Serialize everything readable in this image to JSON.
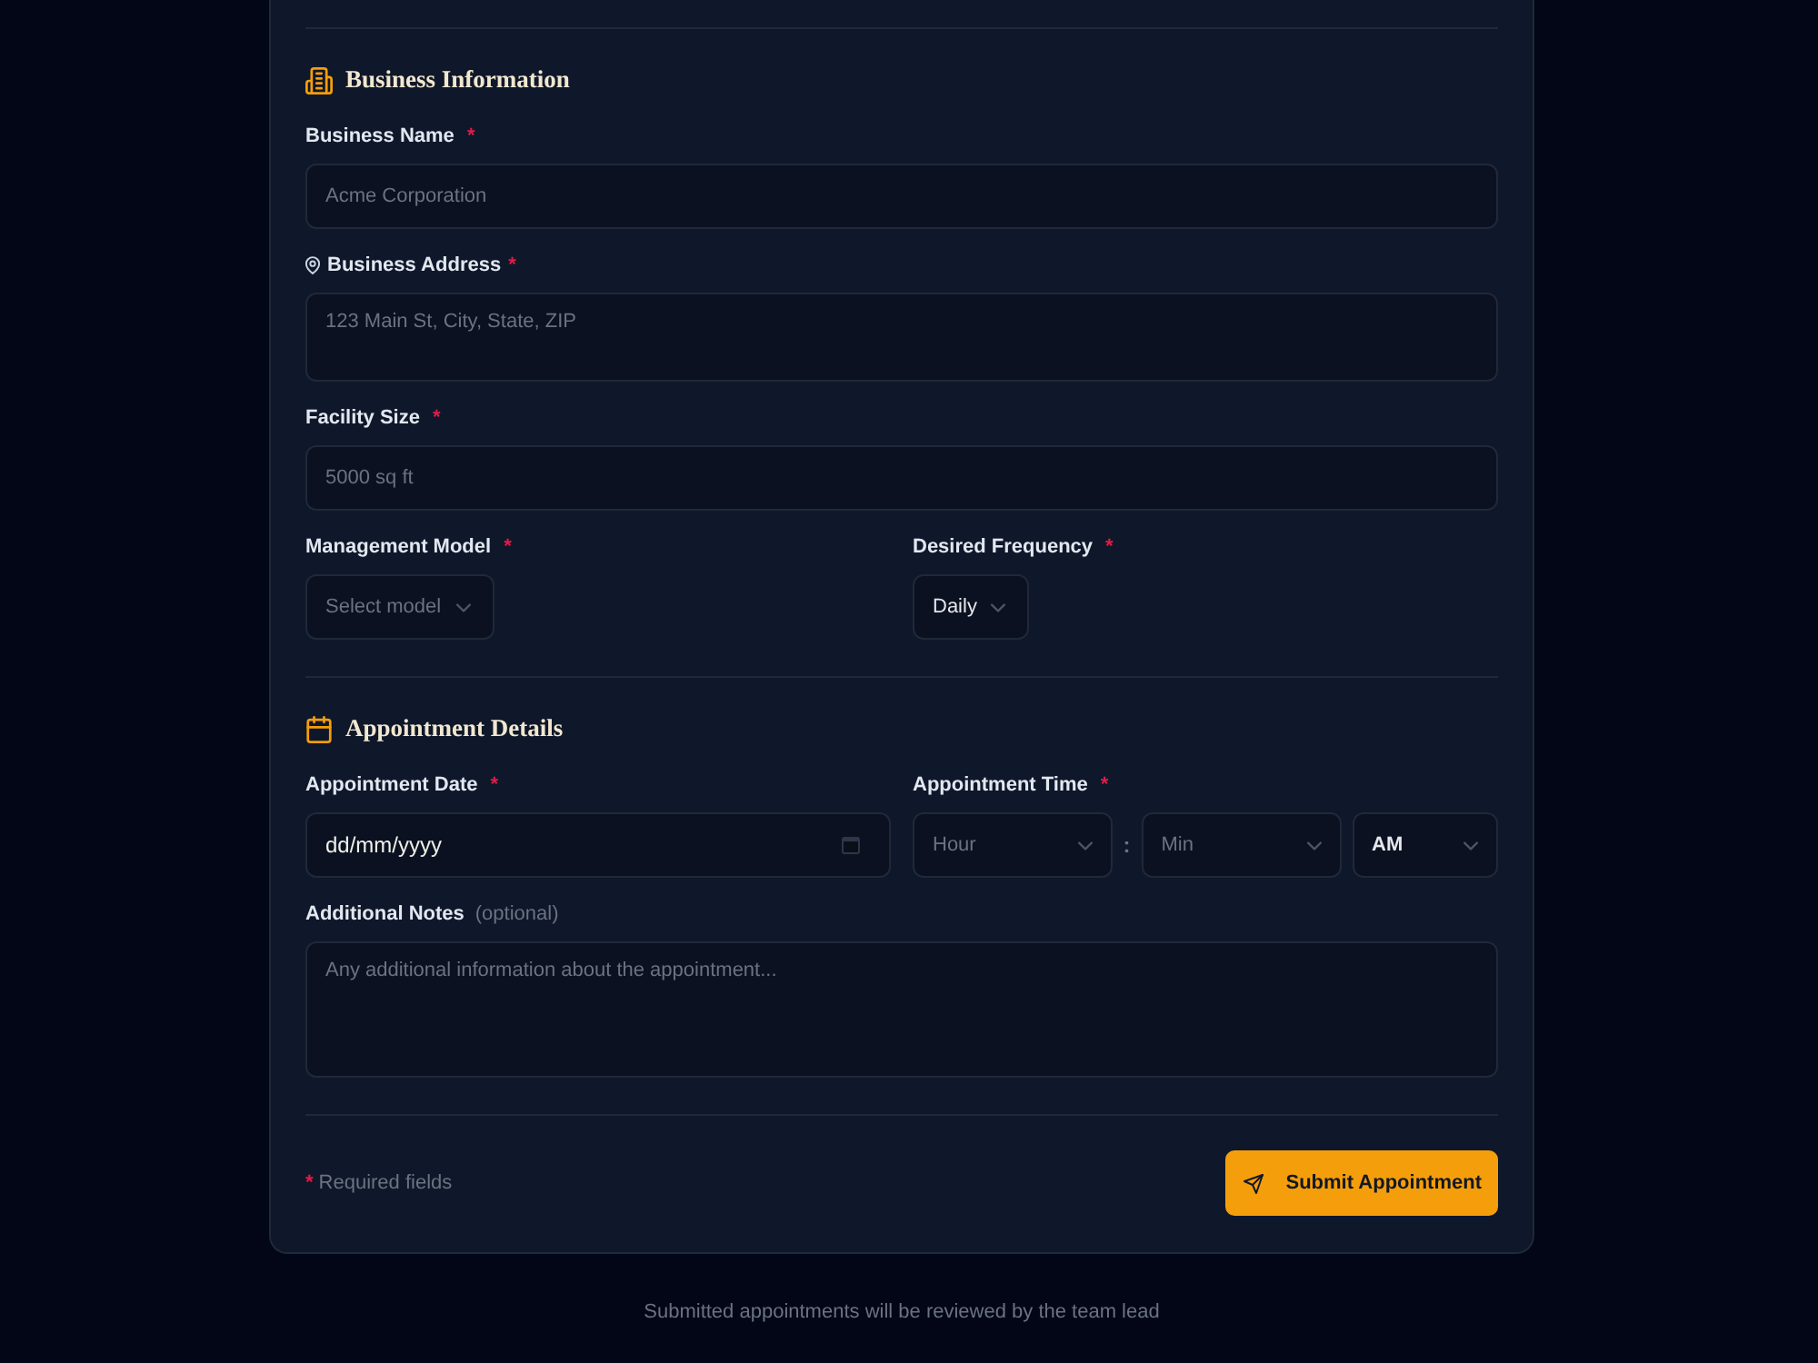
{
  "form": {
    "sections": [
      {
        "kind": "business",
        "title": "Business Information",
        "rows": [
          [
            {
              "kind": "text",
              "label": "Business Name",
              "required_mark": "*",
              "placeholder": "Acme Corporation"
            }
          ],
          [
            {
              "kind": "address",
              "label": "Business Address",
              "required_mark": "*",
              "placeholder": "123 Main St, City, State, ZIP"
            }
          ],
          [
            {
              "kind": "text",
              "label": "Facility Size",
              "required_mark": "*",
              "placeholder": "5000 sq ft"
            }
          ],
          [
            {
              "kind": "select",
              "label": "Management Model",
              "required_mark": "*",
              "placeholder": "Select model"
            },
            {
              "kind": "select",
              "label": "Desired Frequency",
              "required_mark": "*",
              "value": "Daily"
            }
          ]
        ]
      },
      {
        "kind": "schedule",
        "title": "Appointment Details",
        "rows": [
          [
            {
              "kind": "date",
              "label": "Appointment Date",
              "required_mark": "*",
              "value": "dd/mm/yyyy"
            },
            {
              "kind": "time",
              "label": "Appointment Time",
              "required_mark": "*",
              "separator": ":",
              "parts": [
                {
                  "placeholder": "Hour"
                },
                {
                  "placeholder": "Min"
                },
                {
                  "value": "AM"
                }
              ]
            }
          ],
          [
            {
              "kind": "textarea",
              "label": "Additional Notes",
              "hint": "(optional)",
              "placeholder": "Any additional information about the appointment..."
            }
          ]
        ]
      }
    ],
    "footer": {
      "required_mark": "*",
      "required_note": "Required fields",
      "submit_label": "Submit Appointment"
    }
  },
  "page_note": "Submitted appointments will be reviewed by the team lead"
}
